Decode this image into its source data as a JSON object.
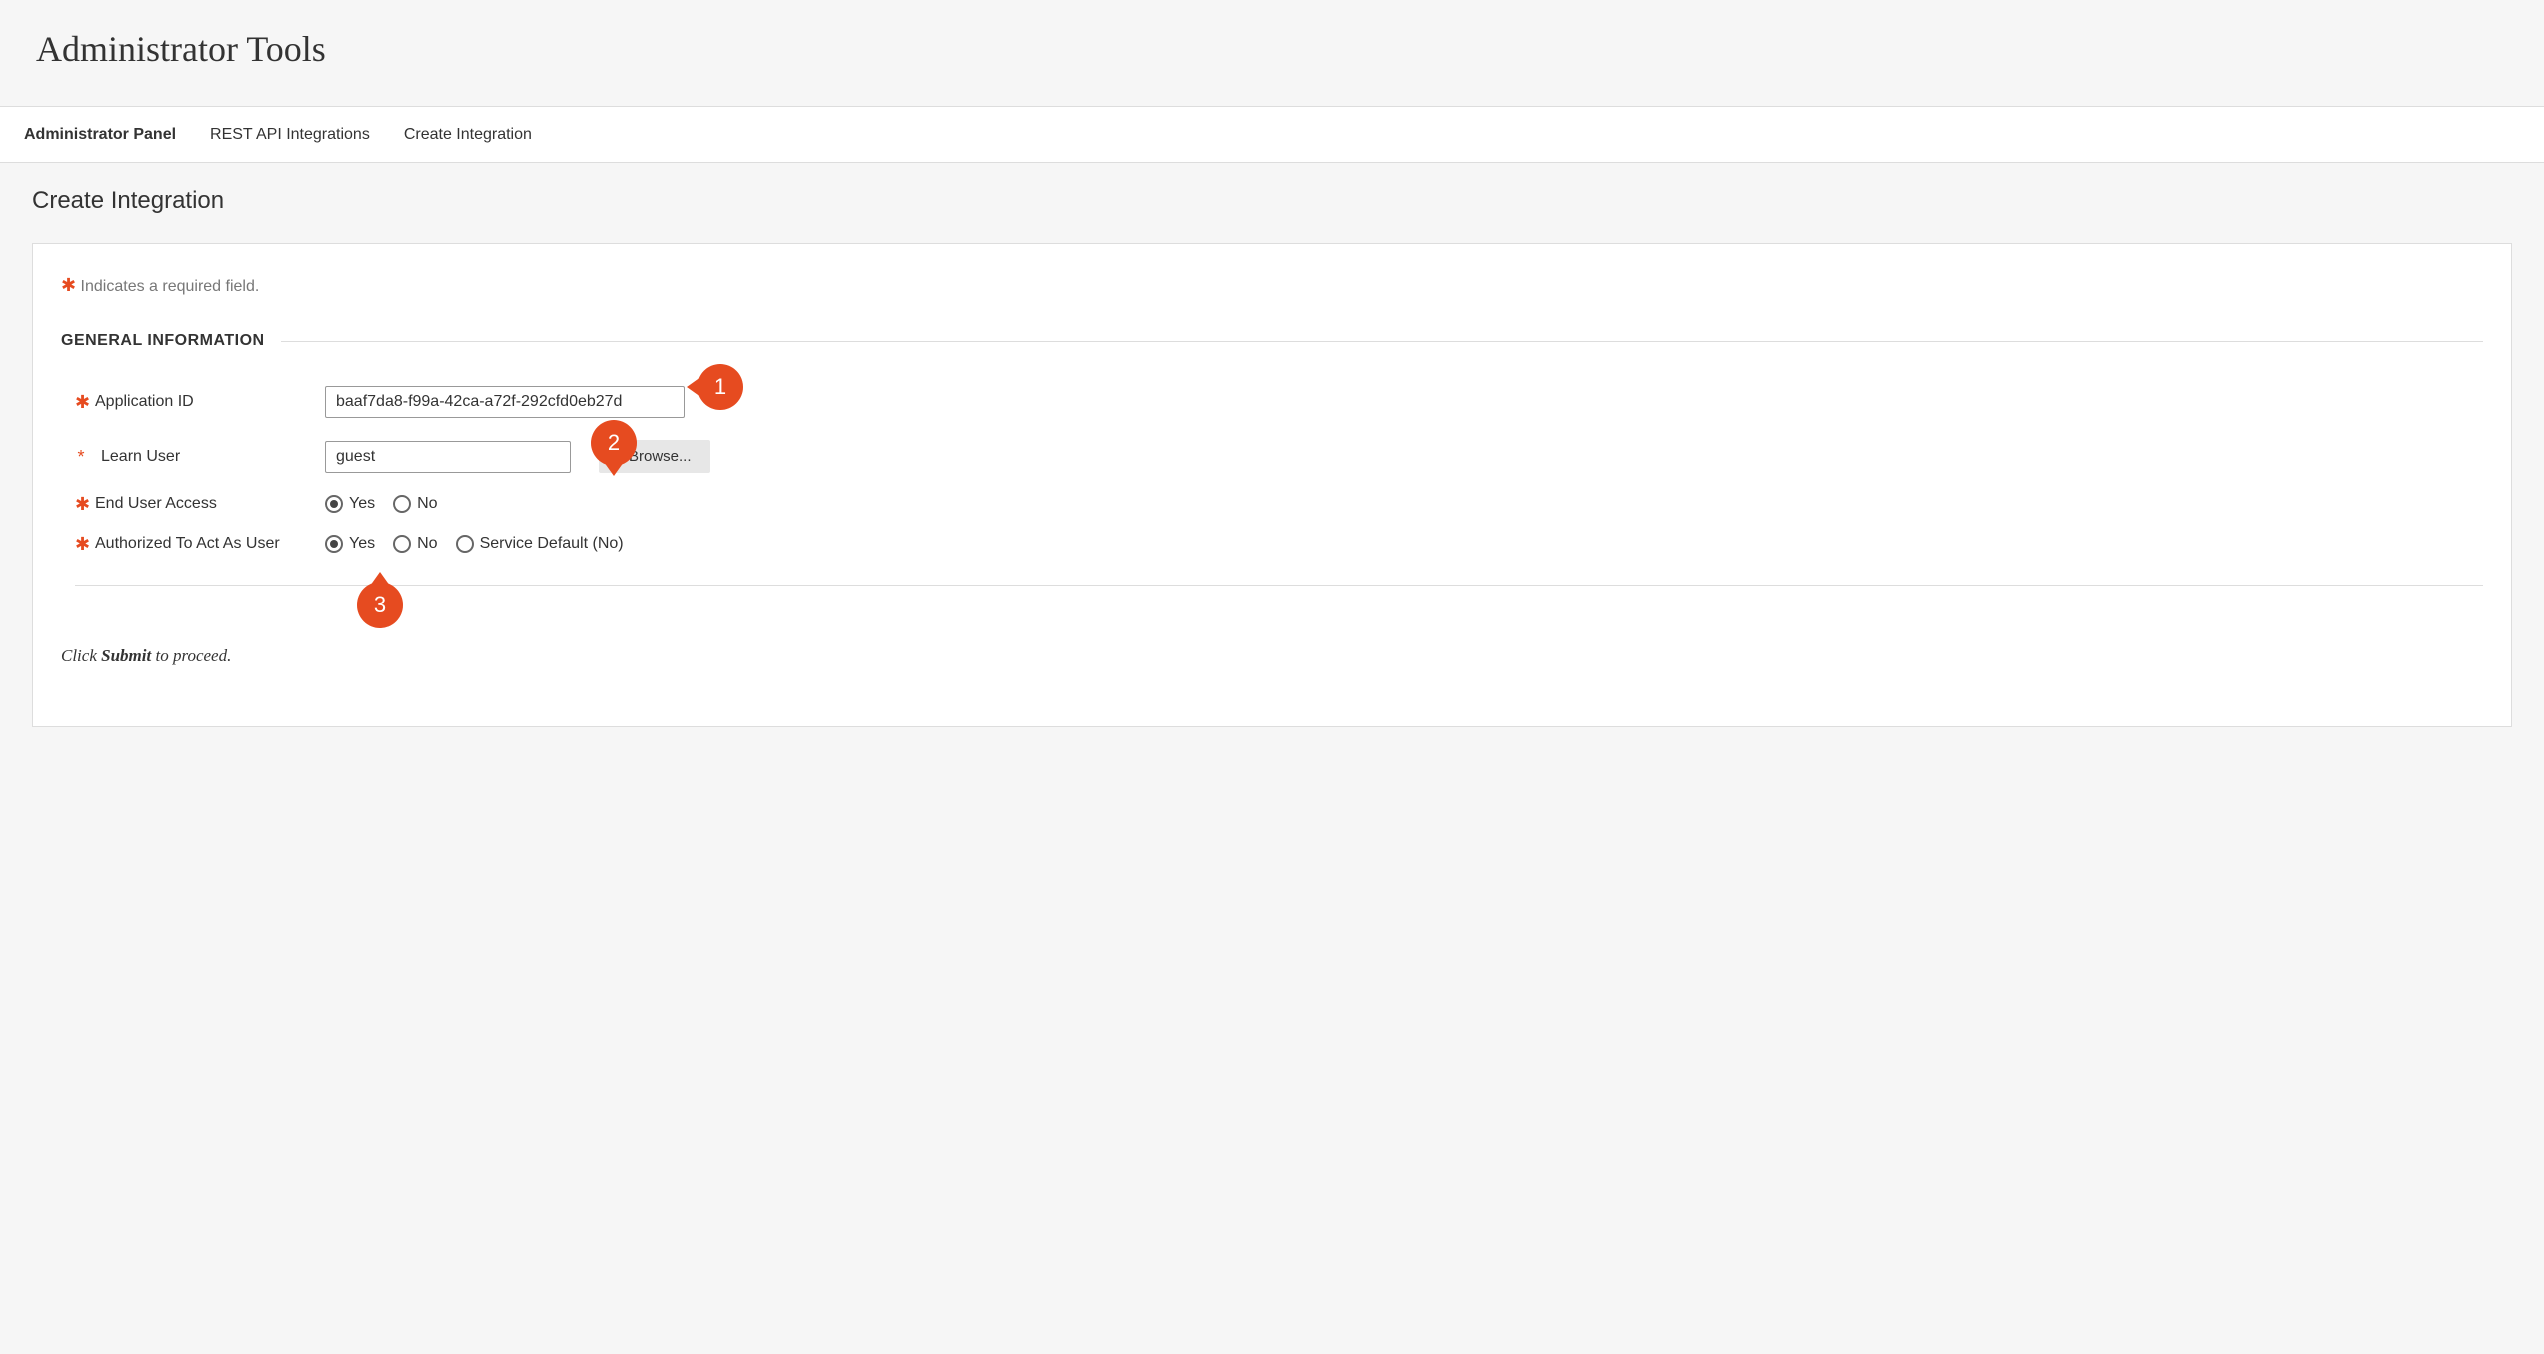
{
  "header": {
    "title": "Administrator Tools"
  },
  "tabs": {
    "items": [
      {
        "label": "Administrator Panel",
        "active": true
      },
      {
        "label": "REST API Integrations",
        "active": false
      },
      {
        "label": "Create Integration",
        "active": false
      }
    ]
  },
  "content": {
    "title": "Create Integration",
    "required_note": "Indicates a required field.",
    "section_title": "GENERAL INFORMATION",
    "fields": {
      "application_id": {
        "label": "Application ID",
        "value": "baaf7da8-f99a-42ca-a72f-292cfd0eb27d"
      },
      "learn_user": {
        "label": "Learn User",
        "value": "guest",
        "browse_label": "Browse..."
      },
      "end_user_access": {
        "label": "End User Access",
        "options": [
          "Yes",
          "No"
        ],
        "selected": "Yes"
      },
      "authorized": {
        "label": "Authorized To Act As User",
        "options": [
          "Yes",
          "No",
          "Service Default (No)"
        ],
        "selected": "Yes"
      }
    },
    "footer_pre": "Click ",
    "footer_bold": "Submit",
    "footer_post": " to proceed."
  },
  "callouts": {
    "c1": "1",
    "c2": "2",
    "c3": "3"
  }
}
